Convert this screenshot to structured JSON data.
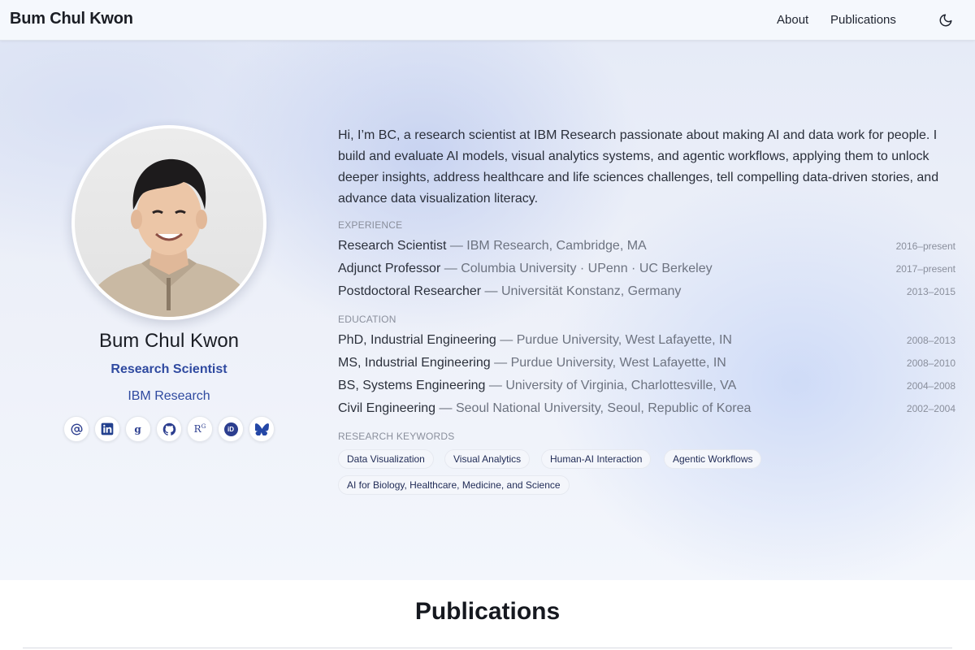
{
  "header": {
    "brand": "Bum Chul Kwon",
    "nav": [
      {
        "label": "About"
      },
      {
        "label": "Publications"
      }
    ],
    "theme_icon": "moon-icon"
  },
  "profile": {
    "name": "Bum Chul Kwon",
    "role": "Research Scientist",
    "org": "IBM Research",
    "socials": [
      {
        "icon": "email-at-icon"
      },
      {
        "icon": "linkedin-icon"
      },
      {
        "icon": "google-scholar-icon"
      },
      {
        "icon": "github-icon"
      },
      {
        "icon": "researchgate-icon",
        "text": "R"
      },
      {
        "icon": "orcid-icon",
        "text": "iD"
      },
      {
        "icon": "bluesky-butterfly-icon"
      }
    ]
  },
  "bio": "Hi, I’m BC, a research scientist at IBM Research passionate about making AI and data work for people. I build and evaluate AI models, visual analytics systems, and agentic workflows, applying them to unlock deeper insights, address healthcare and life sciences challenges, tell compelling data-driven stories, and advance data visualization literacy.",
  "experience": {
    "label": "EXPERIENCE",
    "items": [
      {
        "title": "Research Scientist",
        "place": "IBM Research, Cambridge, MA",
        "years": "2016–present"
      },
      {
        "title": "Adjunct Professor",
        "place": "Columbia University · UPenn · UC Berkeley",
        "years": "2017–present"
      },
      {
        "title": "Postdoctoral Researcher",
        "place": "Universität Konstanz, Germany",
        "years": "2013–2015"
      }
    ]
  },
  "education": {
    "label": "EDUCATION",
    "items": [
      {
        "title": "PhD, Industrial Engineering",
        "place": "Purdue University, West Lafayette, IN",
        "years": "2008–2013"
      },
      {
        "title": "MS, Industrial Engineering",
        "place": "Purdue University, West Lafayette, IN",
        "years": "2008–2010"
      },
      {
        "title": "BS, Systems Engineering",
        "place": "University of Virginia, Charlottesville, VA",
        "years": "2004–2008"
      },
      {
        "title": "Civil Engineering",
        "place": "Seoul National University, Seoul, Republic of Korea",
        "years": "2002–2004"
      }
    ]
  },
  "keywords": {
    "label": "RESEARCH KEYWORDS",
    "items": [
      "Data Visualization",
      "Visual Analytics",
      "Human-AI Interaction",
      "Agentic Workflows",
      "AI for Biology, Healthcare, Medicine, and Science"
    ]
  },
  "publications": {
    "title": "Publications"
  },
  "separator": "—"
}
